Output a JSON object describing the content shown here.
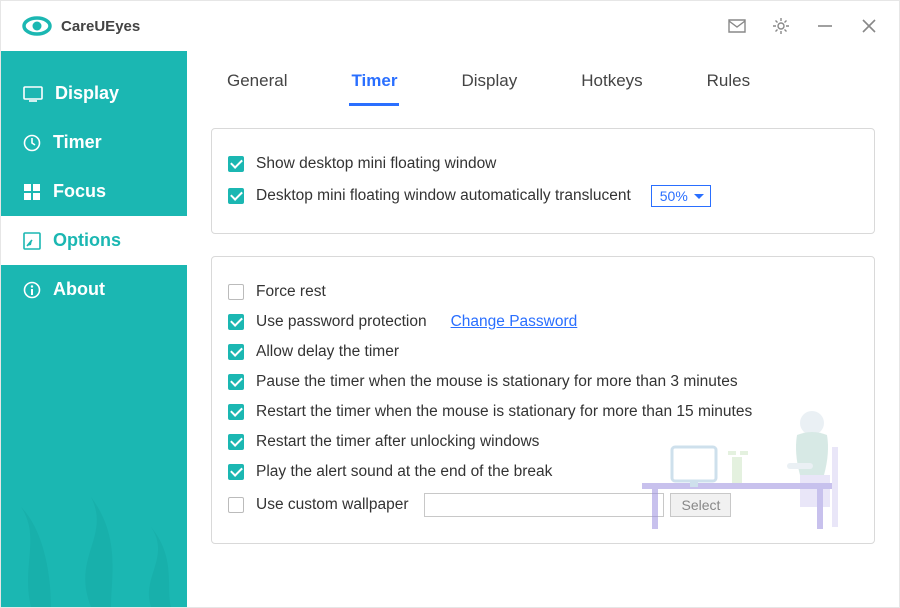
{
  "app": {
    "title": "CareUEyes"
  },
  "sidebar": {
    "items": [
      {
        "label": "Display"
      },
      {
        "label": "Timer"
      },
      {
        "label": "Focus"
      },
      {
        "label": "Options"
      },
      {
        "label": "About"
      }
    ],
    "active_index": 3
  },
  "tabs": {
    "items": [
      {
        "label": "General"
      },
      {
        "label": "Timer"
      },
      {
        "label": "Display"
      },
      {
        "label": "Hotkeys"
      },
      {
        "label": "Rules"
      }
    ],
    "active_index": 1
  },
  "panel1": {
    "show_mini": {
      "checked": true,
      "label": "Show desktop mini floating window"
    },
    "auto_translucent": {
      "checked": true,
      "label": "Desktop mini floating window automatically translucent",
      "value": "50%"
    }
  },
  "panel2": {
    "force_rest": {
      "checked": false,
      "label": "Force rest"
    },
    "password_protect": {
      "checked": true,
      "label": "Use password protection",
      "link_label": "Change Password"
    },
    "allow_delay": {
      "checked": true,
      "label": "Allow delay the timer"
    },
    "pause_mouse": {
      "checked": true,
      "label": "Pause the timer when the mouse is stationary for more than 3 minutes"
    },
    "restart_mouse": {
      "checked": true,
      "label": "Restart the timer when the mouse is stationary for more than 15 minutes"
    },
    "restart_unlock": {
      "checked": true,
      "label": "Restart the timer after unlocking windows"
    },
    "play_alert": {
      "checked": true,
      "label": "Play the alert sound at the end of the break"
    },
    "custom_wallpaper": {
      "checked": false,
      "label": "Use custom wallpaper",
      "path": "",
      "select_label": "Select"
    }
  }
}
